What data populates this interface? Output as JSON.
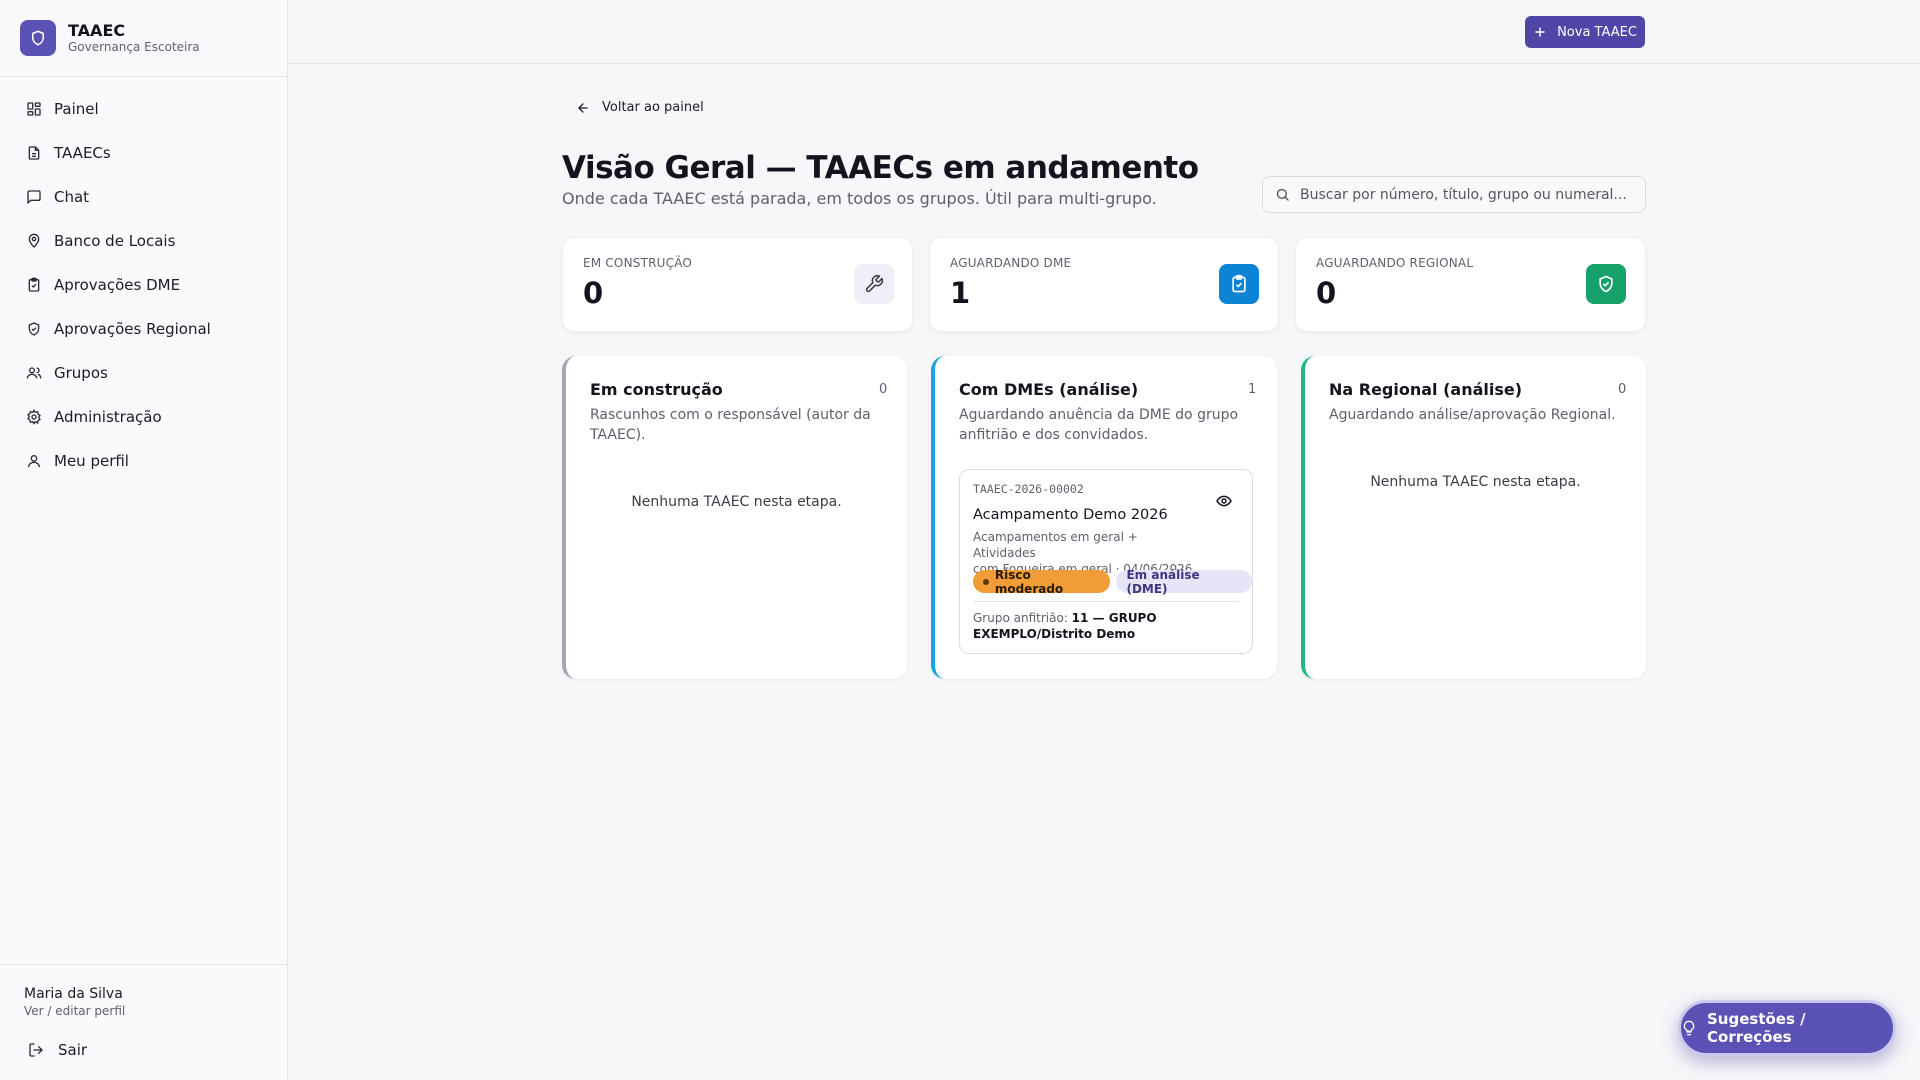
{
  "brand": {
    "name": "TAAEC",
    "subtitle": "Governança Escoteira"
  },
  "nav": {
    "items": [
      {
        "label": "Painel",
        "icon": "dashboard-icon"
      },
      {
        "label": "TAAECs",
        "icon": "document-icon"
      },
      {
        "label": "Chat",
        "icon": "chat-icon"
      },
      {
        "label": "Banco de Locais",
        "icon": "map-pin-icon"
      },
      {
        "label": "Aprovações DME",
        "icon": "clipboard-check-icon"
      },
      {
        "label": "Aprovações Regional",
        "icon": "shield-check-icon"
      },
      {
        "label": "Grupos",
        "icon": "users-icon"
      },
      {
        "label": "Administração",
        "icon": "gear-icon"
      },
      {
        "label": "Meu perfil",
        "icon": "user-icon"
      }
    ]
  },
  "user": {
    "name": "Maria da Silva",
    "profile_link": "Ver / editar perfil",
    "logout": "Sair"
  },
  "topbar": {
    "new_button": "Nova TAAEC"
  },
  "page": {
    "back": "Voltar ao painel",
    "title": "Visão Geral — TAAECs em andamento",
    "subtitle": "Onde cada TAAEC está parada, em todos os grupos. Útil para multi-grupo.",
    "search_placeholder": "Buscar por número, título, grupo ou numeral..."
  },
  "stats": [
    {
      "label": "EM CONSTRUÇÃO",
      "value": "0",
      "icon": "wrench-icon",
      "color": "#f0eff8"
    },
    {
      "label": "AGUARDANDO DME",
      "value": "1",
      "icon": "clipboard-check-icon",
      "color": "#0b84d6"
    },
    {
      "label": "AGUARDANDO REGIONAL",
      "value": "0",
      "icon": "shield-check-icon",
      "color": "#16a06a"
    }
  ],
  "columns": [
    {
      "title": "Em construção",
      "count": "0",
      "desc_lines": [
        "Rascunhos com o responsável (autor da",
        "TAAEC)."
      ],
      "empty": "Nenhuma TAAEC nesta etapa.",
      "accent": "#a4a4b2"
    },
    {
      "title": "Com DMEs (análise)",
      "count": "1",
      "desc_lines": [
        "Aguardando anuência da DME do grupo",
        "anfitrião e dos convidados."
      ],
      "empty": "",
      "accent": "#16a7dd"
    },
    {
      "title": "Na Regional (análise)",
      "count": "0",
      "desc_lines": [
        "Aguardando análise/aprovação Regional."
      ],
      "empty": "Nenhuma TAAEC nesta etapa.",
      "accent": "#1fb886"
    }
  ],
  "card": {
    "code": "TAAEC-2026-00002",
    "title": "Acampamento Demo 2026",
    "meta_lines": [
      "Acampamentos em geral + Atividades",
      "com Fogueira em geral · 04/06/2026"
    ],
    "risk_badge": "Risco moderado",
    "status_badge": "Em análise (DME)",
    "host_label": "Grupo anfitrião:",
    "host_value_1": "11 — GRUPO",
    "host_value_2": "EXEMPLO/Distrito Demo"
  },
  "fab": {
    "label": "Sugestões / Correções"
  }
}
